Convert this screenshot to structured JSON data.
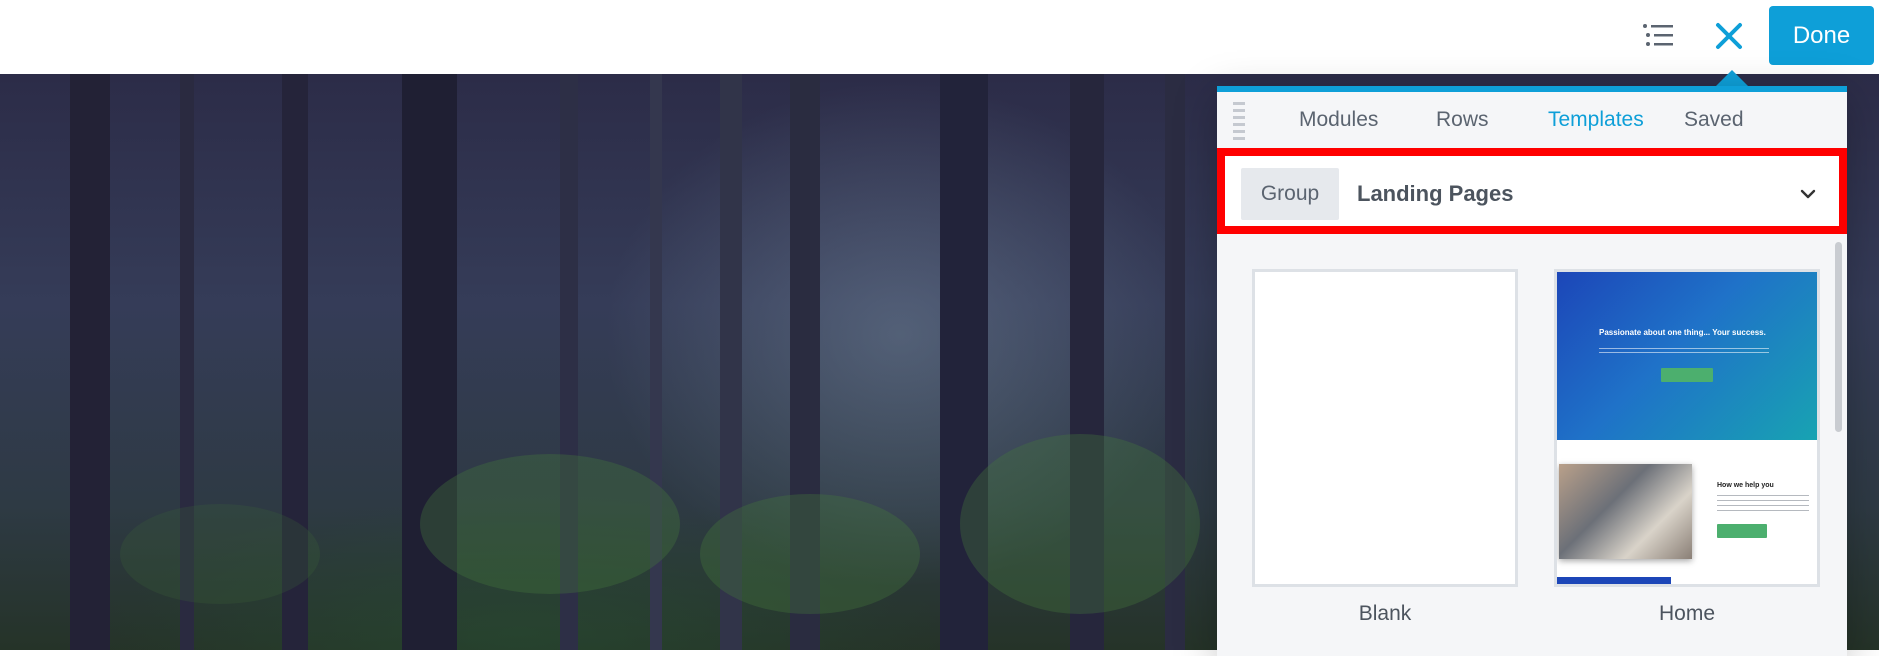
{
  "toolbar": {
    "outline_icon": "list-outline-icon",
    "close_icon": "close-icon",
    "done_label": "Done",
    "accent_color": "#0e9fd8"
  },
  "panel": {
    "tabs": [
      {
        "label": "Modules",
        "active": false
      },
      {
        "label": "Rows",
        "active": false
      },
      {
        "label": "Templates",
        "active": true
      },
      {
        "label": "Saved",
        "active": false
      }
    ],
    "group": {
      "label": "Group",
      "value": "Landing Pages",
      "highlight_color": "#ff0000"
    },
    "templates": [
      {
        "label": "Blank"
      },
      {
        "label": "Home",
        "hero_title": "Passionate about one thing... Your success.",
        "section_title": "How we help you"
      }
    ]
  }
}
